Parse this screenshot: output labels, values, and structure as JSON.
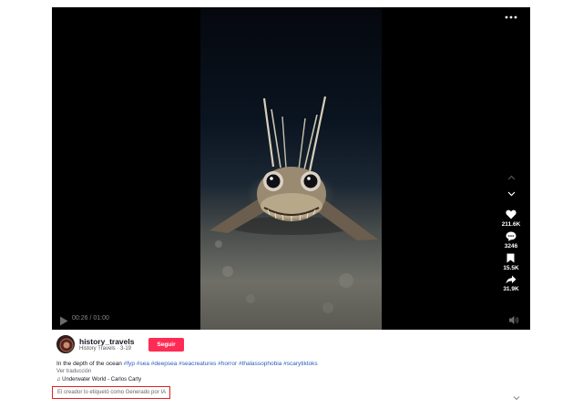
{
  "player": {
    "more_icon": "more-horizontal-icon",
    "nav_up_icon": "chevron-up-icon",
    "nav_down_icon": "chevron-down-icon",
    "time": "00:26 / 01:00",
    "play_icon": "play-icon",
    "volume_icon": "volume-icon",
    "actions": {
      "likes": "211.6K",
      "comments": "3246",
      "saves": "15.5K",
      "shares": "31.9K"
    }
  },
  "author": {
    "username": "history_travels",
    "display_name_date": "History Travels · 3-19",
    "follow_label": "Seguir"
  },
  "post": {
    "caption_text": "In the depth of the ocean ",
    "hashtags": [
      "#fyp",
      "#sea",
      "#deepsea",
      "#seacreatures",
      "#horror",
      "#thalassophobia",
      "#scarytiktoks"
    ],
    "translate_label": "Ver traducción",
    "music": "♫ Underwater World - Carlos Carty",
    "ai_label": "El creador lo etiquetó como Generado por IA"
  },
  "colors": {
    "follow": "#fe2c55",
    "hashtag": "#2b5db9",
    "ai_border": "#e02020"
  }
}
